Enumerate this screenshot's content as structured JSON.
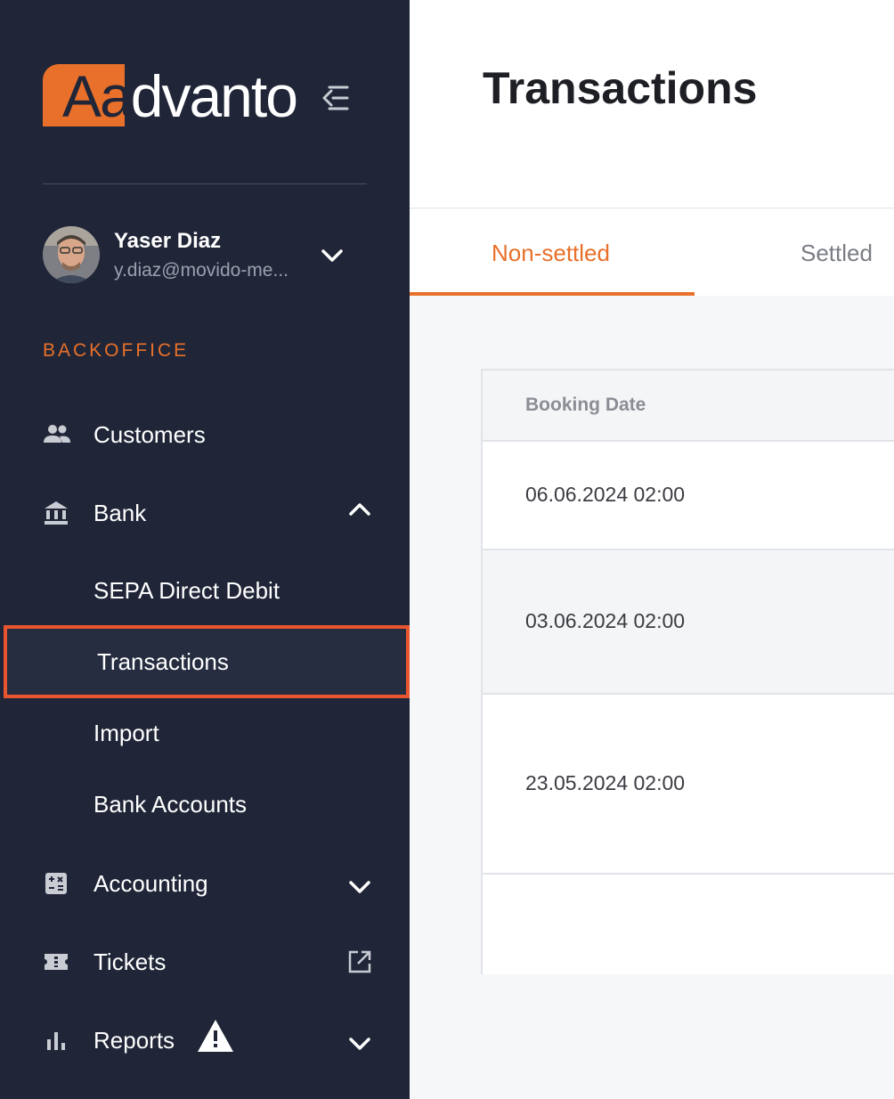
{
  "brand": {
    "logo_text_first": "Aa",
    "logo_text_rest": "dvanto",
    "accent_color": "#e8702a"
  },
  "user": {
    "name": "Yaser Diaz",
    "email": "y.diaz@movido-me..."
  },
  "sidebar": {
    "section_label": "BACKOFFICE",
    "items": [
      {
        "label": "Customers",
        "icon": "people-icon"
      },
      {
        "label": "Bank",
        "icon": "bank-icon",
        "expanded": true
      },
      {
        "label": "SEPA Direct Debit"
      },
      {
        "label": "Transactions",
        "active": true
      },
      {
        "label": "Import"
      },
      {
        "label": "Bank Accounts"
      },
      {
        "label": "Accounting",
        "icon": "calculator-icon"
      },
      {
        "label": "Tickets",
        "icon": "ticket-icon"
      },
      {
        "label": "Reports",
        "icon": "bar-chart-icon",
        "warning": true
      }
    ]
  },
  "page": {
    "title": "Transactions"
  },
  "tabs": [
    {
      "label": "Non-settled",
      "active": true
    },
    {
      "label": "Settled",
      "active": false
    }
  ],
  "table": {
    "columns": [
      "Booking Date"
    ],
    "rows": [
      [
        "06.06.2024 02:00"
      ],
      [
        "03.06.2024 02:00"
      ],
      [
        "23.05.2024 02:00"
      ]
    ]
  }
}
